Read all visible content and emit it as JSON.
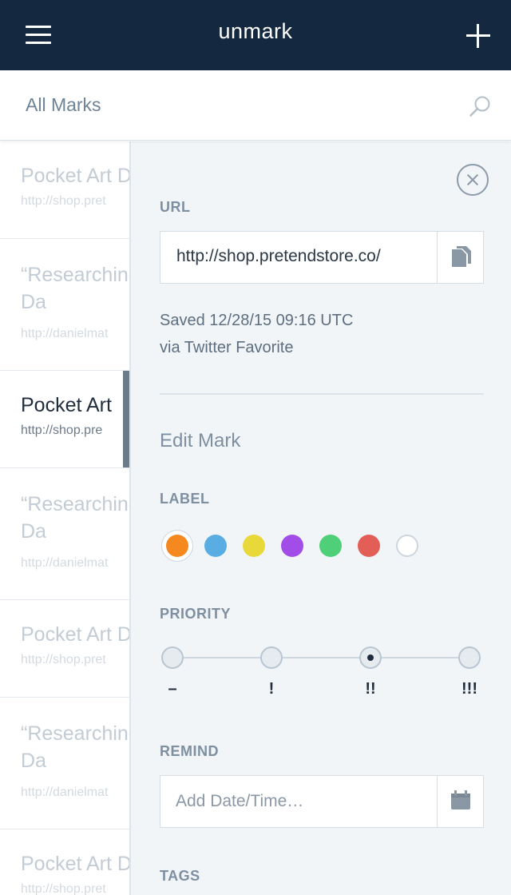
{
  "header": {
    "title": "unmark",
    "menu_icon": "hamburger-menu-icon",
    "add_icon": "plus-icon",
    "background": "#14283f"
  },
  "subheader": {
    "title": "All Marks",
    "search_icon": "search-icon"
  },
  "marks": [
    {
      "title": "Pocket Art D",
      "url": "http://shop.pret",
      "selected": false
    },
    {
      "title": "“Researching article by Da",
      "url": "http://danielmat",
      "selected": false
    },
    {
      "title": "Pocket Art",
      "url": "http://shop.pre",
      "selected": true
    },
    {
      "title": "“Researching article by Da",
      "url": "http://danielmat",
      "selected": false
    },
    {
      "title": "Pocket Art D",
      "url": "http://shop.pret",
      "selected": false
    },
    {
      "title": "“Researching article by Da",
      "url": "http://danielmat",
      "selected": false
    },
    {
      "title": "Pocket Art D",
      "url": "http://shop.pret",
      "selected": false
    }
  ],
  "detail": {
    "url_label": "URL",
    "url_value": "http://shop.pretendstore.co/",
    "saved_line1": "Saved 12/28/15 09:16 UTC",
    "saved_line2": "via Twitter Favorite",
    "edit_heading": "Edit Mark",
    "label_heading": "LABEL",
    "label_colors": [
      "#f5881f",
      "#5aade3",
      "#e8d83a",
      "#a24de8",
      "#4fcf78",
      "#e35e57",
      "none"
    ],
    "selected_label_index": 0,
    "priority_heading": "PRIORITY",
    "priority_levels": [
      "–",
      "!",
      "!!",
      "!!!"
    ],
    "selected_priority_index": 2,
    "remind_heading": "REMIND",
    "remind_placeholder": "Add Date/Time…",
    "tags_heading": "TAGS"
  }
}
